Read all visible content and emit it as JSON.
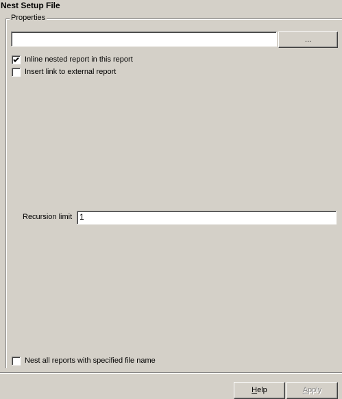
{
  "dialog": {
    "title": "Nest Setup File",
    "group_label": "Properties"
  },
  "file": {
    "value": "",
    "browse_label": "..."
  },
  "options": {
    "inline_label": "Inline nested report in this report",
    "inline_checked": true,
    "link_label": "Insert link to external report",
    "link_checked": false,
    "nest_all_label": "Nest all reports with specified file name",
    "nest_all_checked": false
  },
  "recursion": {
    "label": "Recursion limit",
    "value": "1"
  },
  "buttons": {
    "help_label": "Help",
    "help_mnemonic": "H",
    "help_rest": "elp",
    "apply_label": "Apply",
    "apply_mnemonic": "A",
    "apply_rest": "pply"
  }
}
